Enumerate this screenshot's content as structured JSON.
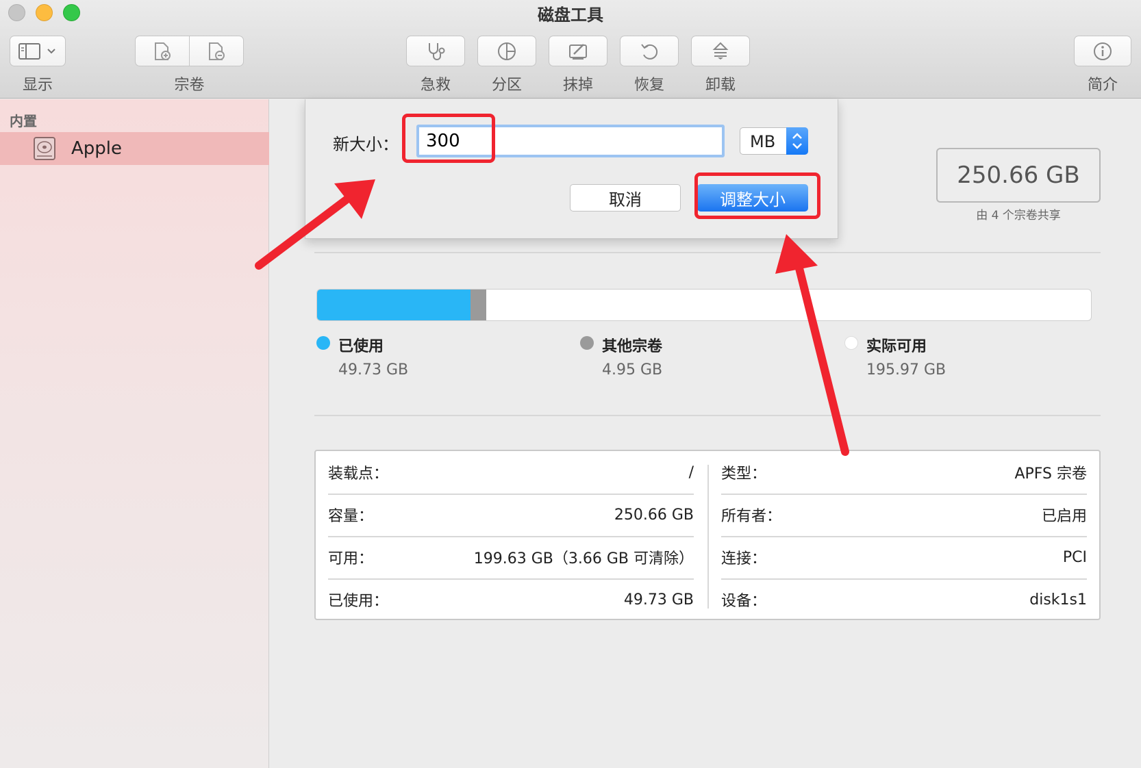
{
  "window": {
    "title": "磁盘工具"
  },
  "toolbar": {
    "view_label": "显示",
    "volume_label": "宗卷",
    "firstaid_label": "急救",
    "partition_label": "分区",
    "erase_label": "抹掉",
    "restore_label": "恢复",
    "unmount_label": "卸载",
    "info_label": "简介"
  },
  "sidebar": {
    "section": "内置",
    "items": [
      {
        "label": "Apple",
        "icon": "disk-icon"
      }
    ]
  },
  "capacity": {
    "value": "250.66 GB",
    "shared_note": "由 4 个宗卷共享"
  },
  "usage": {
    "total_gb": 250.66,
    "segments": [
      {
        "name": "已使用",
        "value": "49.73 GB",
        "gb": 49.73,
        "color": "#29b6f6"
      },
      {
        "name": "其他宗卷",
        "value": "4.95 GB",
        "gb": 4.95,
        "color": "#9a9a9a"
      },
      {
        "name": "实际可用",
        "value": "195.97 GB",
        "gb": 195.97,
        "color": "#ffffff"
      }
    ]
  },
  "info": {
    "left": [
      {
        "key": "装载点：",
        "value": "/"
      },
      {
        "key": "容量：",
        "value": "250.66 GB"
      },
      {
        "key": "可用：",
        "value": "199.63 GB（3.66 GB 可清除）"
      },
      {
        "key": "已使用：",
        "value": "49.73 GB"
      }
    ],
    "right": [
      {
        "key": "类型：",
        "value": "APFS 宗卷"
      },
      {
        "key": "所有者：",
        "value": "已启用"
      },
      {
        "key": "连接：",
        "value": "PCI"
      },
      {
        "key": "设备：",
        "value": "disk1s1"
      }
    ]
  },
  "dialog": {
    "label": "新大小：",
    "size_value": "300",
    "unit": "MB",
    "cancel_label": "取消",
    "resize_label": "调整大小"
  },
  "annotation_color": "#f0242f"
}
